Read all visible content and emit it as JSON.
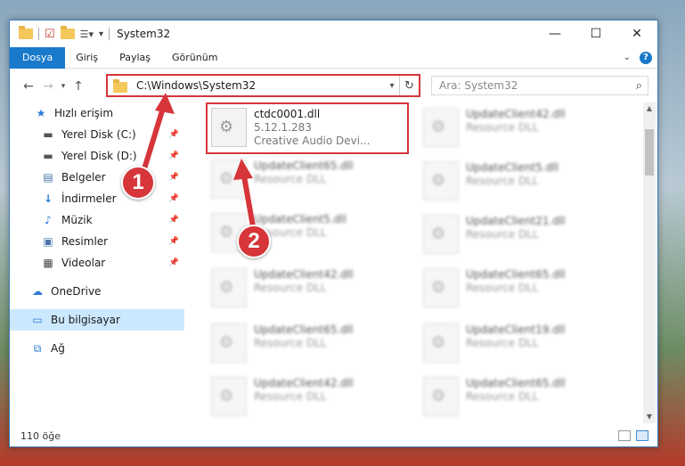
{
  "window": {
    "title": "System32",
    "controls": {
      "minimize": "—",
      "maximize": "☐",
      "close": "✕"
    }
  },
  "ribbon": {
    "tabs": [
      "Dosya",
      "Giriş",
      "Paylaş",
      "Görünüm"
    ]
  },
  "address": {
    "path": "C:\\Windows\\System32",
    "search_placeholder": "Ara: System32"
  },
  "sidebar": {
    "items": [
      {
        "label": "Hızlı erişim",
        "icon": "star-icon",
        "pinned": false
      },
      {
        "label": "Yerel Disk (C:)",
        "icon": "drive-icon",
        "pinned": true
      },
      {
        "label": "Yerel Disk (D:)",
        "icon": "drive-icon",
        "pinned": true
      },
      {
        "label": "Belgeler",
        "icon": "documents-icon",
        "pinned": true
      },
      {
        "label": "İndirmeler",
        "icon": "download-icon",
        "pinned": true
      },
      {
        "label": "Müzik",
        "icon": "music-icon",
        "pinned": true
      },
      {
        "label": "Resimler",
        "icon": "pictures-icon",
        "pinned": true
      },
      {
        "label": "Videolar",
        "icon": "videos-icon",
        "pinned": true
      },
      {
        "label": "OneDrive",
        "icon": "cloud-icon",
        "pinned": false
      },
      {
        "label": "Bu bilgisayar",
        "icon": "computer-icon",
        "pinned": false
      },
      {
        "label": "Ağ",
        "icon": "network-icon",
        "pinned": false
      }
    ]
  },
  "files": {
    "highlighted": {
      "name": "ctdc0001.dll",
      "version": "5.12.1.283",
      "desc": "Creative Audio Devi..."
    },
    "col1": [
      {
        "name": "UpdateClient65.dll",
        "desc": "Resource DLL"
      },
      {
        "name": "UpdateClient5.dll",
        "desc": "Resource DLL"
      },
      {
        "name": "UpdateClient42.dll",
        "desc": "Resource DLL"
      },
      {
        "name": "UpdateClient65.dll",
        "desc": "Resource DLL"
      },
      {
        "name": "UpdateClient42.dll",
        "desc": "Resource DLL"
      }
    ],
    "col2": [
      {
        "name": "UpdateClient42.dll",
        "desc": "Resource DLL"
      },
      {
        "name": "UpdateClient5.dll",
        "desc": "Resource DLL"
      },
      {
        "name": "UpdateClient21.dll",
        "desc": "Resource DLL"
      },
      {
        "name": "UpdateClient65.dll",
        "desc": "Resource DLL"
      },
      {
        "name": "UpdateClient19.dll",
        "desc": "Resource DLL"
      },
      {
        "name": "UpdateClient65.dll",
        "desc": "Resource DLL"
      }
    ]
  },
  "status": {
    "count": "110 öğe"
  },
  "annotations": {
    "step1": "1",
    "step2": "2",
    "color": "#d6353a"
  }
}
